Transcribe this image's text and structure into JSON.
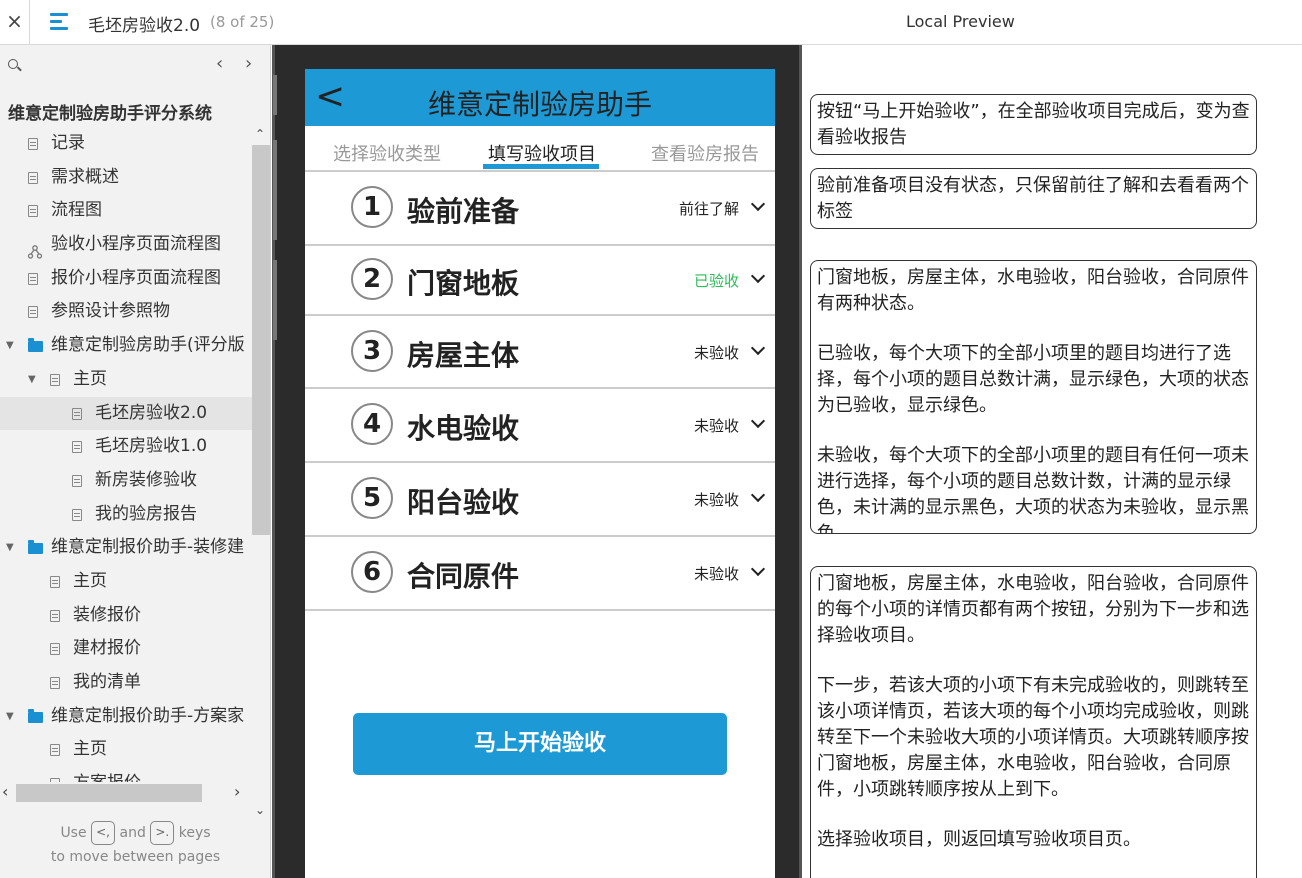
{
  "topbar": {
    "close": "×",
    "title": "毛坯房验收2.0",
    "count": "(8 of 25)",
    "preview": "Local Preview"
  },
  "sidebar": {
    "project_title": "维意定制验房助手评分系统",
    "items": [
      {
        "label": "记录",
        "type": "page",
        "level": 1
      },
      {
        "label": "需求概述",
        "type": "page",
        "level": 1
      },
      {
        "label": "流程图",
        "type": "page",
        "level": 1
      },
      {
        "label": "验收小程序页面流程图",
        "type": "flow",
        "level": 1
      },
      {
        "label": "报价小程序页面流程图",
        "type": "page",
        "level": 1
      },
      {
        "label": "参照设计参照物",
        "type": "page",
        "level": 1
      },
      {
        "label": "维意定制验房助手(评分版",
        "type": "folder",
        "level": 0
      },
      {
        "label": "主页",
        "type": "page",
        "level": 2,
        "expanded": true
      },
      {
        "label": "毛坯房验收2.0",
        "type": "page",
        "level": 3,
        "selected": true
      },
      {
        "label": "毛坯房验收1.0",
        "type": "page",
        "level": 3
      },
      {
        "label": "新房装修验收",
        "type": "page",
        "level": 3
      },
      {
        "label": "我的验房报告",
        "type": "page",
        "level": 3
      },
      {
        "label": "维意定制报价助手-装修建",
        "type": "folder",
        "level": 0
      },
      {
        "label": "主页",
        "type": "page",
        "level": 2
      },
      {
        "label": "装修报价",
        "type": "page",
        "level": 2
      },
      {
        "label": "建材报价",
        "type": "page",
        "level": 2
      },
      {
        "label": "我的清单",
        "type": "page",
        "level": 2
      },
      {
        "label": "维意定制报价助手-方案家",
        "type": "folder",
        "level": 0
      },
      {
        "label": "主页",
        "type": "page",
        "level": 2
      },
      {
        "label": "方案报价",
        "type": "page",
        "level": 2
      }
    ],
    "hint_use": "Use",
    "hint_and": "and",
    "hint_keys": "keys",
    "hint_line2": "to move between pages",
    "key_prev": "<,",
    "key_next": ">."
  },
  "app": {
    "back": "<",
    "title": "维意定制验房助手",
    "tabs": [
      "选择验收类型",
      "填写验收项目",
      "查看验房报告"
    ],
    "active_tab": 1,
    "rows": [
      {
        "num": "1",
        "name": "验前准备",
        "status": "前往了解",
        "done": false
      },
      {
        "num": "2",
        "name": "门窗地板",
        "status": "已验收",
        "done": true
      },
      {
        "num": "3",
        "name": "房屋主体",
        "status": "未验收",
        "done": false
      },
      {
        "num": "4",
        "name": "水电验收",
        "status": "未验收",
        "done": false
      },
      {
        "num": "5",
        "name": "阳台验收",
        "status": "未验收",
        "done": false
      },
      {
        "num": "6",
        "name": "合同原件",
        "status": "未验收",
        "done": false
      }
    ],
    "start_button": "马上开始验收",
    "colors": {
      "primary": "#1d9ad6",
      "done": "#2bbd5a"
    }
  },
  "notes": [
    {
      "paras": [
        "按钮“马上开始验收”，在全部验收项目完成后，变为查看验收报告"
      ]
    },
    {
      "paras": [
        "验前准备项目没有状态，只保留前往了解和去看看两个标签"
      ]
    },
    {
      "paras": [
        "门窗地板，房屋主体，水电验收，阳台验收，合同原件有两种状态。",
        "已验收，每个大项下的全部小项里的题目均进行了选择，每个小项的题目总数计满，显示绿色，大项的状态为已验收，显示绿色。",
        "未验收，每个大项下的全部小项里的题目有任何一项未进行选择，每个小项的题目总数计数，计满的显示绿色，未计满的显示黑色，大项的状态为未验收，显示黑色。"
      ]
    },
    {
      "paras": [
        "门窗地板，房屋主体，水电验收，阳台验收，合同原件的每个小项的详情页都有两个按钮，分别为下一步和选择验收项目。",
        "下一步，若该大项的小项下有未完成验收的，则跳转至该小项详情页，若该大项的每个小项均完成验收，则跳转至下一个未验收大项的小项详情页。大项跳转顺序按门窗地板，房屋主体，水电验收，阳台验收，合同原件，小项跳转顺序按从上到下。",
        "选择验收项目，则返回填写验收项目页。"
      ]
    }
  ]
}
